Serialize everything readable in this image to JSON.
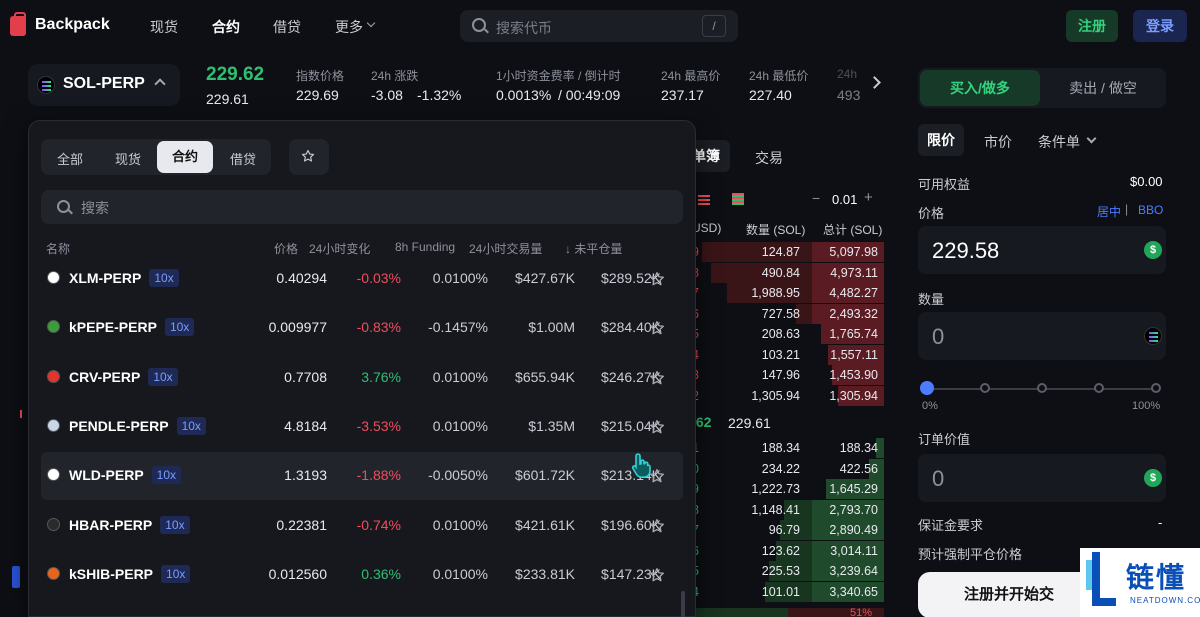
{
  "nav": {
    "brand": "Backpack",
    "items": [
      "现货",
      "合约",
      "借贷",
      "更多"
    ],
    "active_index": 1,
    "search_placeholder": "搜索代币",
    "search_shortcut": "/",
    "register": "注册",
    "login": "登录"
  },
  "market": {
    "symbol": "SOL-PERP",
    "last_price": "229.62",
    "mark_price": "229.61",
    "stats": [
      {
        "label": "指数价格",
        "value": "229.69"
      },
      {
        "label": "24h 涨跌",
        "value": "-3.08",
        "value2": "-1.32%"
      },
      {
        "label": "1小时资金费率 / 倒计时",
        "value": "0.0013%",
        "value2": " / 00:49:09"
      },
      {
        "label": "24h 最高价",
        "value": "237.17"
      },
      {
        "label": "24h 最低价",
        "value": "227.40"
      },
      {
        "label": "24h",
        "value": "493"
      }
    ]
  },
  "dropdown": {
    "tabs": [
      "全部",
      "现货",
      "合约",
      "借贷"
    ],
    "active_tab": 2,
    "search_placeholder": "搜索",
    "columns": [
      "名称",
      "价格",
      "24小时变化",
      "8h Funding",
      "24小时交易量",
      "↓ 未平仓量"
    ],
    "rows": [
      {
        "name": "XLM-PERP",
        "lev": "10x",
        "price": "0.40294",
        "change": "-0.03%",
        "funding": "0.0100%",
        "volume": "$427.67K",
        "oi": "$289.52K",
        "color": "#ffffff"
      },
      {
        "name": "kPEPE-PERP",
        "lev": "10x",
        "price": "0.009977",
        "change": "-0.83%",
        "funding": "-0.1457%",
        "volume": "$1.00M",
        "oi": "$284.40K",
        "color": "#3b9c3b"
      },
      {
        "name": "CRV-PERP",
        "lev": "10x",
        "price": "0.7708",
        "change": "3.76%",
        "funding": "0.0100%",
        "volume": "$655.94K",
        "oi": "$246.27K",
        "color": "#e0342d"
      },
      {
        "name": "PENDLE-PERP",
        "lev": "10x",
        "price": "4.8184",
        "change": "-3.53%",
        "funding": "0.0100%",
        "volume": "$1.35M",
        "oi": "$215.04K",
        "color": "#c9d6e8"
      },
      {
        "name": "WLD-PERP",
        "lev": "10x",
        "price": "1.3193",
        "change": "-1.88%",
        "funding": "-0.0050%",
        "volume": "$601.72K",
        "oi": "$213.14K",
        "color": "#ffffff"
      },
      {
        "name": "HBAR-PERP",
        "lev": "10x",
        "price": "0.22381",
        "change": "-0.74%",
        "funding": "0.0100%",
        "volume": "$421.61K",
        "oi": "$196.60K",
        "color": "#2a2a2a"
      },
      {
        "name": "kSHIB-PERP",
        "lev": "10x",
        "price": "0.012560",
        "change": "0.36%",
        "funding": "0.0100%",
        "volume": "$233.81K",
        "oi": "$147.23K",
        "color": "#e8641b"
      }
    ],
    "highlight_index": 4
  },
  "orderbook": {
    "tabs": [
      "单簿",
      "交易"
    ],
    "step": "0.01",
    "headers": [
      "USD)",
      "数量 (SOL)",
      "总计 (SOL)"
    ],
    "asks": [
      {
        "p": "9",
        "s": "124.87",
        "t": "5,097.98",
        "bar": 0.95
      },
      {
        "p": "8",
        "s": "490.84",
        "t": "4,973.11",
        "bar": 0.9
      },
      {
        "p": "7",
        "s": "1,988.95",
        "t": "4,482.27",
        "bar": 0.82
      },
      {
        "p": "6",
        "s": "727.58",
        "t": "2,493.32",
        "bar": 0.46
      },
      {
        "p": "5",
        "s": "208.63",
        "t": "1,765.74",
        "bar": 0.33
      },
      {
        "p": "4",
        "s": "103.21",
        "t": "1,557.11",
        "bar": 0.29
      },
      {
        "p": "3",
        "s": "147.96",
        "t": "1,453.90",
        "bar": 0.27
      },
      {
        "p": "2",
        "s": "1,305.94",
        "t": "1,305.94",
        "bar": 0.24
      }
    ],
    "mid": ".62",
    "mid2": "229.61",
    "bids": [
      {
        "p": "1",
        "s": "188.34",
        "t": "188.34",
        "bar": 0.04
      },
      {
        "p": "0",
        "s": "234.22",
        "t": "422.56",
        "bar": 0.08
      },
      {
        "p": "9",
        "s": "1,222.73",
        "t": "1,645.29",
        "bar": 0.3
      },
      {
        "p": "8",
        "s": "1,148.41",
        "t": "2,793.70",
        "bar": 0.52
      },
      {
        "p": "7",
        "s": "96.79",
        "t": "2,890.49",
        "bar": 0.54
      },
      {
        "p": "6",
        "s": "123.62",
        "t": "3,014.11",
        "bar": 0.56
      },
      {
        "p": "5",
        "s": "225.53",
        "t": "3,239.64",
        "bar": 0.6
      },
      {
        "p": "4",
        "s": "101.01",
        "t": "3,340.65",
        "bar": 0.62
      }
    ],
    "ratio": "51%"
  },
  "trade": {
    "buy": "买入/做多",
    "sell": "卖出 / 做空",
    "order_types": [
      "限价",
      "市价",
      "条件单"
    ],
    "equity_label": "可用权益",
    "equity_value": "$0.00",
    "price_label": "价格",
    "mid_link": "居中",
    "bbo_link": "BBO",
    "price_value": "229.58",
    "qty_label": "数量",
    "qty_value": "0",
    "slider_min": "0%",
    "slider_max": "100%",
    "order_value_label": "订单价值",
    "order_value": "0",
    "margin_label": "保证金要求",
    "margin_value": "-",
    "liq_label": "预计强制平仓价格",
    "cta": "注册并开始交",
    "coin_symbol": "$"
  },
  "watermark": {
    "cn": "链懂",
    "en": "NEATDOWN.COM"
  }
}
